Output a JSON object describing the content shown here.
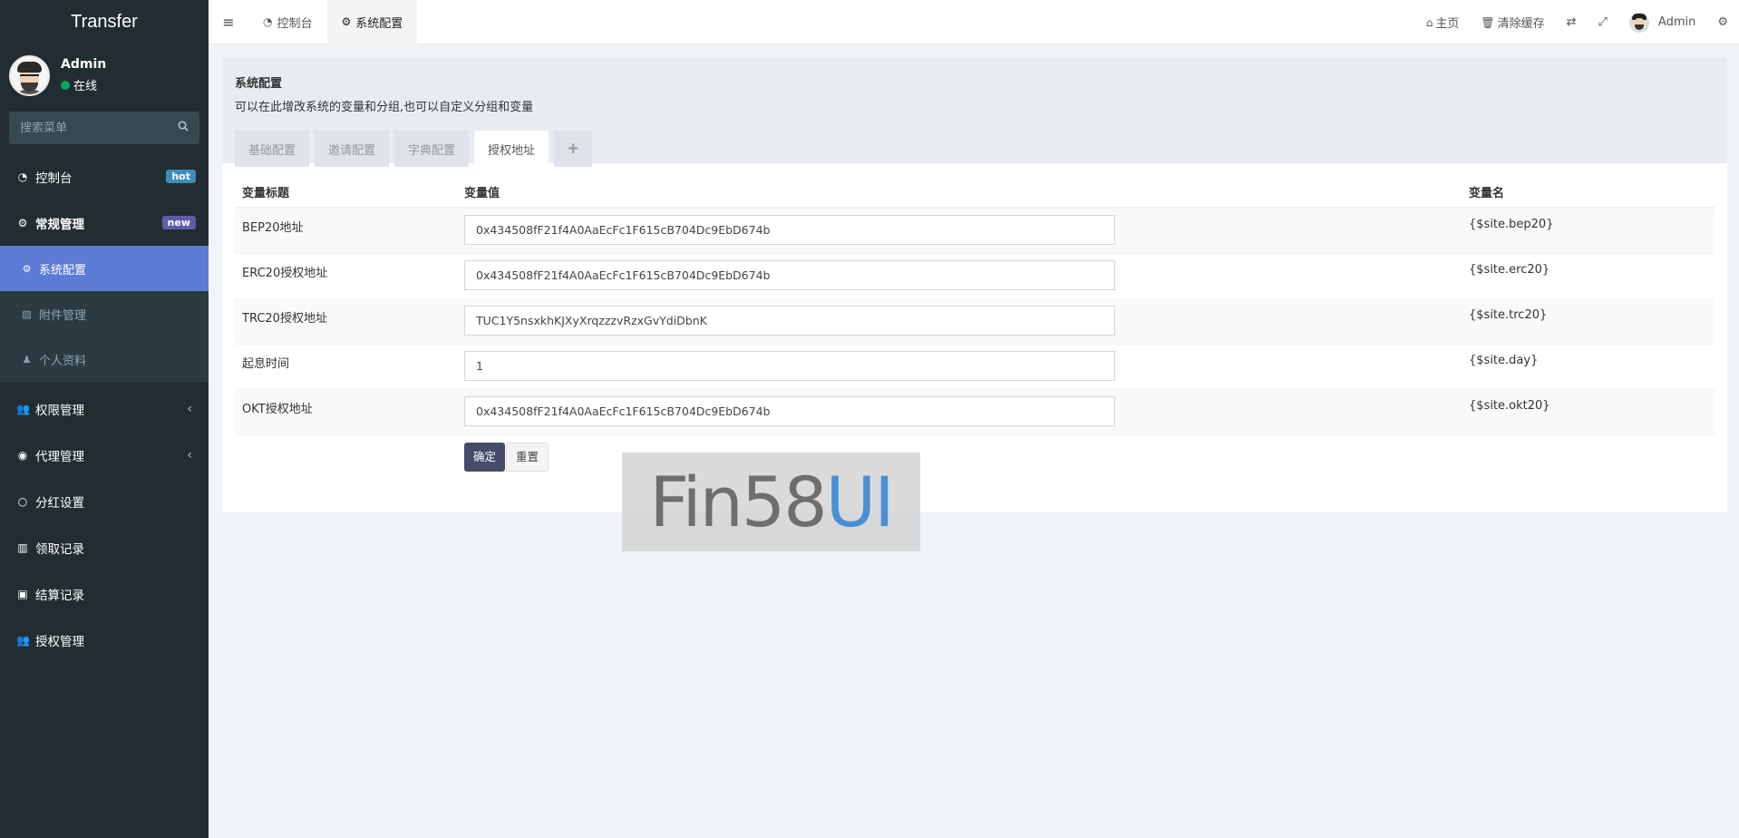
{
  "app": {
    "brand": "Transfer"
  },
  "user": {
    "name": "Admin",
    "status": "在线"
  },
  "search": {
    "placeholder": "搜索菜单"
  },
  "sidebar": {
    "dashboard": {
      "label": "控制台",
      "badge": "hot"
    },
    "general": {
      "label": "常规管理",
      "badge": "new"
    },
    "sub_items": [
      {
        "label": "系统配置"
      },
      {
        "label": "附件管理"
      },
      {
        "label": "个人资料"
      }
    ],
    "items": [
      {
        "label": "权限管理"
      },
      {
        "label": "代理管理"
      },
      {
        "label": "分红设置"
      },
      {
        "label": "领取记录"
      },
      {
        "label": "结算记录"
      },
      {
        "label": "授权管理"
      }
    ]
  },
  "topbar": {
    "tabs": [
      {
        "label": "控制台"
      },
      {
        "label": "系统配置"
      }
    ],
    "home": "主页",
    "clear_cache": "清除缓存",
    "admin": "Admin"
  },
  "panel": {
    "title": "系统配置",
    "description": "可以在此增改系统的变量和分组,也可以自定义分组和变量",
    "tabs": [
      "基础配置",
      "邀请配置",
      "字典配置",
      "授权地址",
      "+"
    ],
    "columns": [
      "变量标题",
      "变量值",
      "变量名"
    ],
    "rows": [
      {
        "title": "BEP20地址",
        "value": "0x434508fF21f4A0AaEcFc1F615cB704Dc9EbD674b",
        "name": "{$site.bep20}"
      },
      {
        "title": "ERC20授权地址",
        "value": "0x434508fF21f4A0AaEcFc1F615cB704Dc9EbD674b",
        "name": "{$site.erc20}"
      },
      {
        "title": "TRC20授权地址",
        "value": "TUC1Y5nsxkhKJXyXrqzzzvRzxGvYdiDbnK",
        "name": "{$site.trc20}"
      },
      {
        "title": "起息时间",
        "value": "1",
        "name": "{$site.day}"
      },
      {
        "title": "OKT授权地址",
        "value": "0x434508fF21f4A0AaEcFc1F615cB704Dc9EbD674b",
        "name": "{$site.okt20}"
      }
    ],
    "submit": "确定",
    "reset": "重置"
  },
  "watermark": {
    "part1": "Fin58",
    "part2": "UI"
  }
}
